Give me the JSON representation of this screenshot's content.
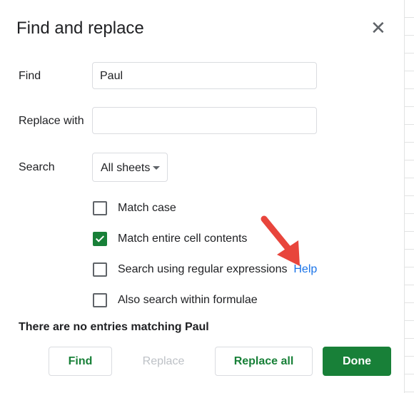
{
  "dialog": {
    "title": "Find and replace",
    "close_icon": "close-icon"
  },
  "find": {
    "label": "Find",
    "value": "Paul"
  },
  "replace": {
    "label": "Replace with",
    "value": ""
  },
  "search": {
    "label": "Search",
    "selected": "All sheets"
  },
  "options": [
    {
      "label": "Match case",
      "checked": false
    },
    {
      "label": "Match entire cell contents",
      "checked": true
    },
    {
      "label": "Search using regular expressions",
      "checked": false,
      "link": "Help"
    },
    {
      "label": "Also search within formulae",
      "checked": false
    }
  ],
  "message": "There are no entries matching Paul",
  "buttons": {
    "find": "Find",
    "replace": "Replace",
    "replace_all": "Replace all",
    "done": "Done"
  },
  "colors": {
    "accent": "#188038",
    "link": "#1a73e8",
    "annotation_arrow": "#e8453c"
  }
}
